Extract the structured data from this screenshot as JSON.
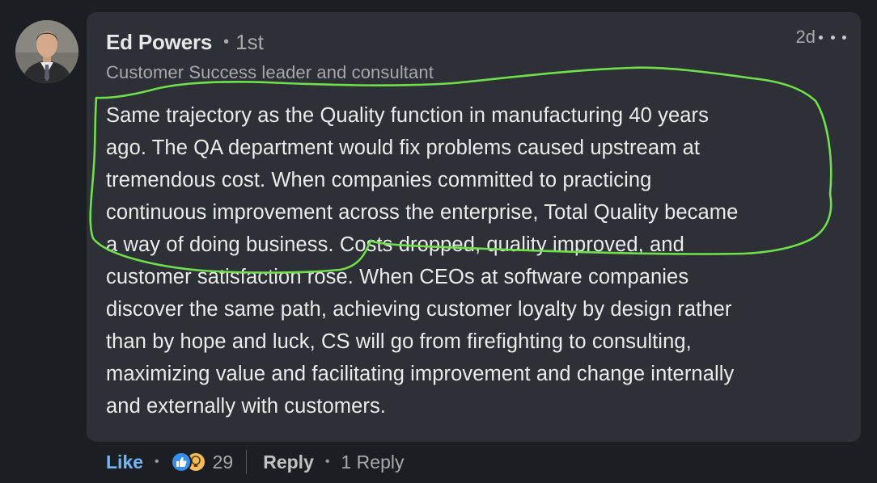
{
  "author": {
    "name": "Ed Powers",
    "degree": "1st",
    "headline": "Customer Success leader and consultant"
  },
  "comment": {
    "time": "2d",
    "lines": [
      "Same trajectory as the Quality function in manufacturing 40 years",
      "ago. The QA department would fix problems caused upstream at",
      "tremendous cost. When companies committed to practicing",
      "continuous improvement across the enterprise, Total Quality became",
      "a way of doing business. Costs dropped, quality improved, and",
      "customer satisfaction rose. When CEOs at software companies",
      "discover the same path, achieving customer loyalty by design rather",
      "than by hope and luck, CS will go from firefighting to consulting,",
      "maximizing value and facilitating improvement and change internally",
      "and externally with customers."
    ]
  },
  "actions": {
    "like_label": "Like",
    "reaction_count": "29",
    "reply_label": "Reply",
    "reply_count": "1 Reply"
  },
  "icons": {
    "reactions": [
      "like-reaction-icon",
      "insightful-reaction-icon"
    ],
    "more": "ellipsis-icon"
  },
  "colors": {
    "accent": "#71b7fb",
    "annotation": "#6fe04a",
    "bubble": "#2d3036",
    "background": "#1b1f23"
  }
}
